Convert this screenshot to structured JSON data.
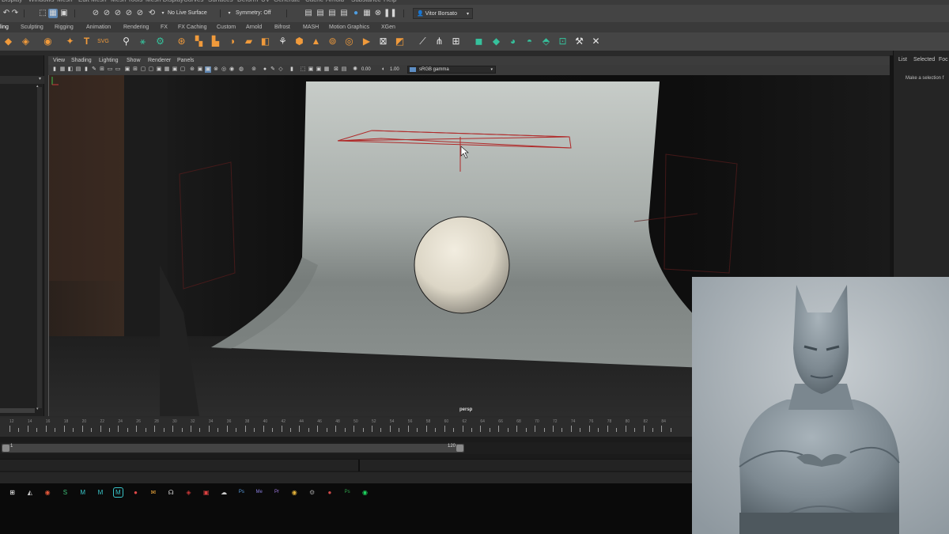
{
  "menubar": {
    "items": [
      "Display",
      "Windows",
      "Mesh",
      "Edit Mesh",
      "Mesh Tools",
      "Mesh Display",
      "Curves",
      "Surfaces",
      "Deform",
      "UV",
      "Generate",
      "Cache",
      "Arnold",
      "Substance",
      "Help"
    ]
  },
  "statusline": {
    "live_surface": "No Live Surface",
    "symmetry": "Symmetry: Off",
    "user": "Vitor Borsato"
  },
  "shelf": {
    "tabs": [
      "ling",
      "Sculpting",
      "Rigging",
      "Animation",
      "Rendering",
      "FX",
      "FX Caching",
      "Custom",
      "Arnold",
      "Bifrost",
      "MASH",
      "Motion Graphics",
      "XGen"
    ],
    "active_tab": "ling"
  },
  "viewport": {
    "menus": [
      "View",
      "Shading",
      "Lighting",
      "Show",
      "Renderer",
      "Panels"
    ],
    "exposure": "0.00",
    "gamma": "1.00",
    "color_space": "sRGB gamma",
    "camera": "persp"
  },
  "channel_box": {
    "tabs": [
      "List",
      "Selected",
      "Foc"
    ],
    "hint": "Make a selection f"
  },
  "timeline": {
    "ticks": [
      "12",
      "14",
      "16",
      "18",
      "20",
      "22",
      "24",
      "26",
      "28",
      "30",
      "32",
      "34",
      "36",
      "38",
      "40",
      "42",
      "44",
      "46",
      "48",
      "50",
      "52",
      "54",
      "56",
      "58",
      "60",
      "62",
      "64",
      "66",
      "68",
      "70",
      "72",
      "74",
      "76",
      "78",
      "80",
      "82",
      "84"
    ],
    "range_start": "1",
    "range_end": "120"
  },
  "taskbar": {
    "apps": [
      {
        "icon": "windows-icon",
        "color": "#ffffff"
      },
      {
        "icon": "app-icon",
        "color": "#cfcfcf"
      },
      {
        "icon": "chrome-icon",
        "color": "#e2573a"
      },
      {
        "icon": "sheets-icon",
        "color": "#3fc37a"
      },
      {
        "icon": "maya-icon",
        "color": "#39c4c8"
      },
      {
        "icon": "maya-icon",
        "color": "#39c4c8"
      },
      {
        "icon": "maya-active-icon",
        "color": "#39c4c8"
      },
      {
        "icon": "record-icon",
        "color": "#e04848"
      },
      {
        "icon": "mail-icon",
        "color": "#e8a33a"
      },
      {
        "icon": "headset-icon",
        "color": "#d6d6d6"
      },
      {
        "icon": "game-icon",
        "color": "#c93838"
      },
      {
        "icon": "adobe-icon",
        "color": "#d94040"
      },
      {
        "icon": "cloud-icon",
        "color": "#cfcfcf"
      },
      {
        "icon": "photoshop-icon",
        "color": "#5a9de0"
      },
      {
        "icon": "media-encoder-icon",
        "color": "#8a7fe0"
      },
      {
        "icon": "premiere-icon",
        "color": "#a07ae0"
      },
      {
        "icon": "chrome-icon",
        "color": "#e3b23a"
      },
      {
        "icon": "tools-icon",
        "color": "#9a9a9a"
      },
      {
        "icon": "record-icon",
        "color": "#d14a4a"
      },
      {
        "icon": "photoshop-alt-icon",
        "color": "#2ea04a"
      },
      {
        "icon": "spotify-icon",
        "color": "#1ed760"
      }
    ]
  }
}
